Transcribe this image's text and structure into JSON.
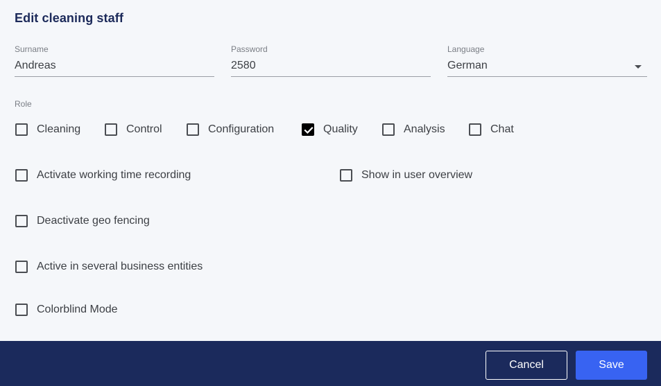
{
  "dialog": {
    "title": "Edit cleaning staff",
    "fields": {
      "surname": {
        "label": "Surname",
        "value": "Andreas"
      },
      "password": {
        "label": "Password",
        "value": "2580"
      },
      "language": {
        "label": "Language",
        "value": "German"
      }
    },
    "role": {
      "label": "Role",
      "options": [
        {
          "label": "Cleaning",
          "checked": false
        },
        {
          "label": "Control",
          "checked": false
        },
        {
          "label": "Configuration",
          "checked": false
        },
        {
          "label": "Quality",
          "checked": true
        },
        {
          "label": "Analysis",
          "checked": false
        },
        {
          "label": "Chat",
          "checked": false
        }
      ]
    },
    "options": {
      "working_time": {
        "label": "Activate working time recording",
        "checked": false
      },
      "user_overview": {
        "label": "Show in user overview",
        "checked": false
      },
      "geo_fencing": {
        "label": "Deactivate geo fencing",
        "checked": false
      },
      "several_entities": {
        "label": "Active in several business entities",
        "checked": false
      },
      "colorblind": {
        "label": "Colorblind Mode",
        "checked": false
      }
    }
  },
  "footer": {
    "cancel_label": "Cancel",
    "save_label": "Save"
  },
  "colors": {
    "title": "#1c2a5a",
    "footer_bg": "#1b2a5c",
    "save_bg": "#3863f2"
  }
}
